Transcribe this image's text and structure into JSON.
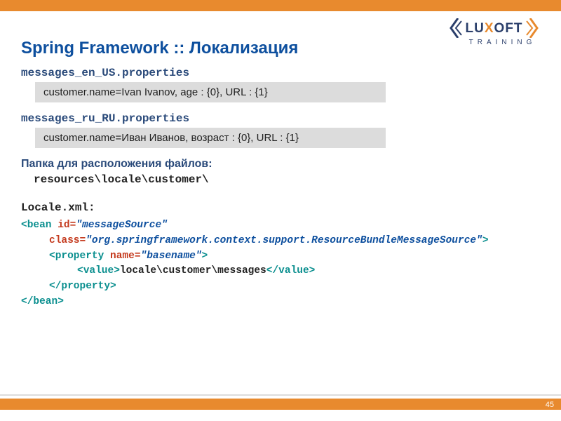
{
  "title": "Spring Framework :: Локализация",
  "files": {
    "en_label": "messages_en_US.properties",
    "en_content": "customer.name=Ivan Ivanov, age : {0}, URL : {1}",
    "ru_label": "messages_ru_RU.properties",
    "ru_content": "customer.name=Иван Иванов, возраст : {0}, URL : {1}"
  },
  "folder": {
    "label": "Папка для расположения файлов:",
    "path": "resources\\locale\\customer\\"
  },
  "locale": {
    "label": "Locale.xml:",
    "bean_open": "<bean ",
    "id_attr": "id=",
    "id_val": "\"messageSource\"",
    "class_attr": "class=",
    "class_val": "\"org.springframework.context.support.ResourceBundleMessageSource\"",
    "close_angle": ">",
    "prop_open": "<property ",
    "name_attr": "name=",
    "name_val": "\"basename\"",
    "value_open": "<value>",
    "value_text": "locale\\customer\\messages",
    "value_close": "</value>",
    "prop_close": "</property>",
    "bean_close": "</bean>"
  },
  "page_number": "45",
  "logo": {
    "brand_pre": "LU",
    "brand_x": "X",
    "brand_post": "OFT",
    "training": "TRAINING"
  }
}
